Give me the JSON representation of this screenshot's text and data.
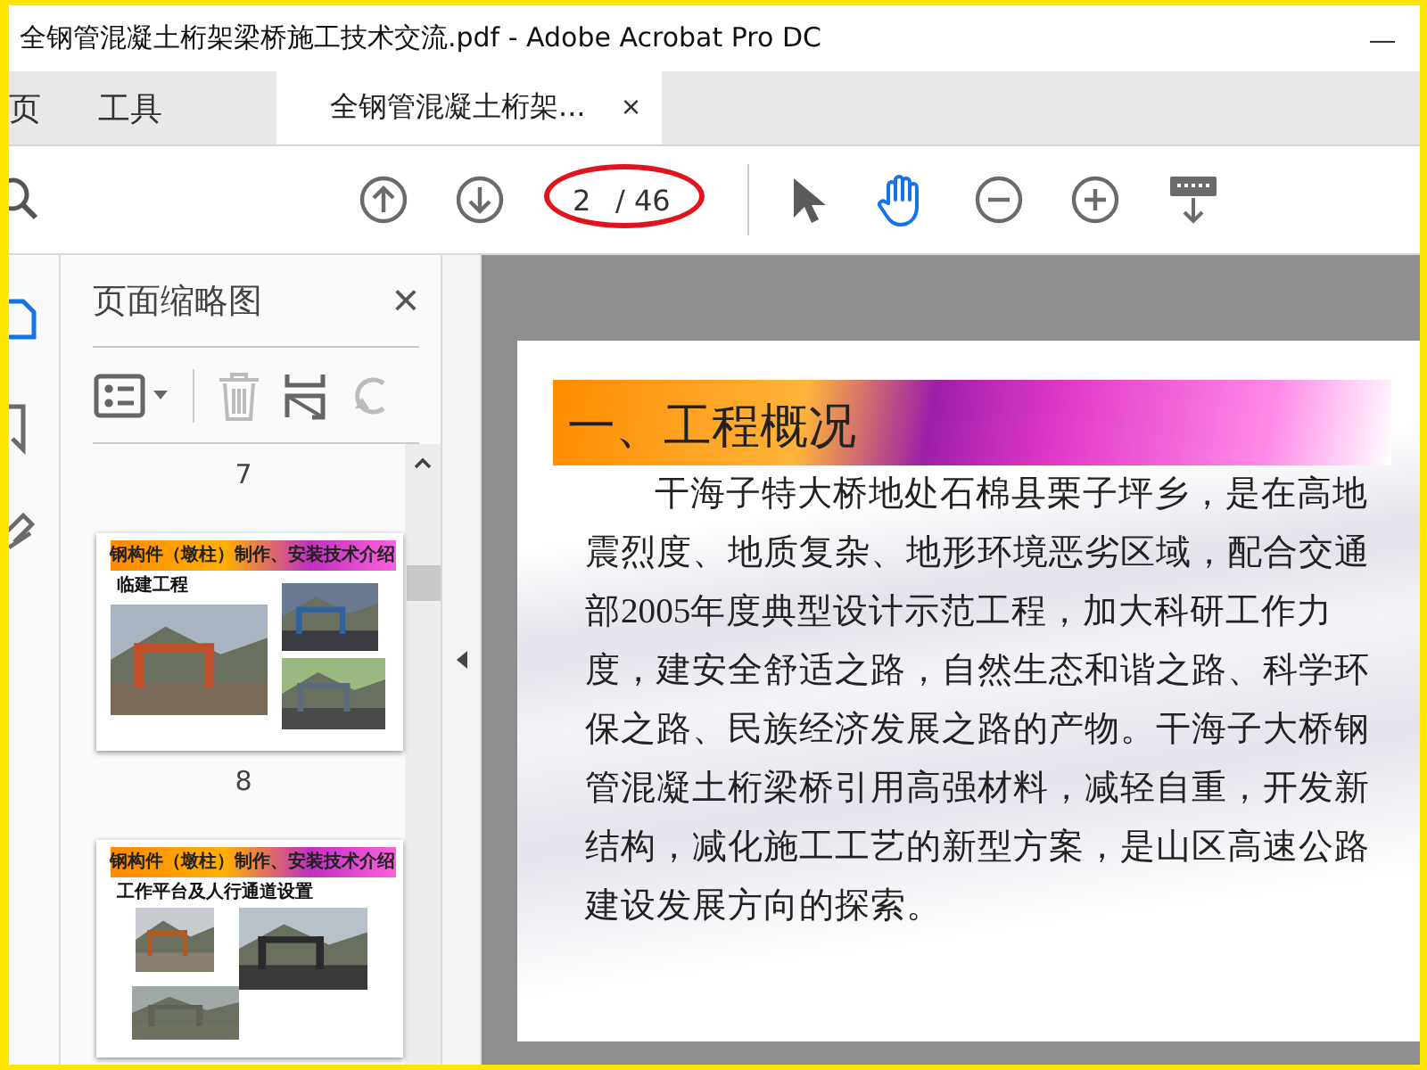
{
  "window": {
    "title": "全钢管混凝土桁架梁桥施工技术交流.pdf - Adobe Acrobat Pro DC",
    "minimize": "—"
  },
  "tabs": [
    {
      "label": "页",
      "selected": false
    },
    {
      "label": "工具",
      "selected": false
    },
    {
      "label": "全钢管混凝土桁架...",
      "selected": true,
      "close": "×"
    }
  ],
  "toolbar": {
    "page_field": {
      "value": "2",
      "total": "/ 46"
    },
    "tools": [
      {
        "kind": "select",
        "selected": false
      },
      {
        "kind": "hand",
        "selected": true
      }
    ]
  },
  "side_rail": [
    {
      "kind": "thumbnails",
      "selected": true
    },
    {
      "kind": "bookmarks",
      "selected": false
    },
    {
      "kind": "signatures",
      "selected": false
    }
  ],
  "thumbnails_panel": {
    "title": "页面缩略图",
    "close": "×",
    "items": [
      {
        "kind": "label",
        "text": "7"
      },
      {
        "kind": "thumbnail",
        "slide_title": "钢构件（墩柱）制作、安装技术介绍",
        "caption": "临建工程"
      },
      {
        "kind": "label",
        "text": "8"
      },
      {
        "kind": "thumbnail",
        "slide_title": "钢构件（墩柱）制作、安装技术介绍",
        "caption": "工作平台及人行通道设置"
      }
    ]
  },
  "document": {
    "heading": "一、工程概况",
    "paragraph": "干海子特大桥地处石棉县栗子坪乡，是在高地震烈度、地质复杂、地形环境恶劣区域，配合交通部2005年度典型设计示范工程，加大科研工作力度，建安全舒适之路，自然生态和谐之路、科学环保之路、民族经济发展之路的产物。干海子大桥钢管混凝土桁梁桥引用高强材料，减轻自重，开发新结构，减化施工工艺的新型方案，是山区高速公路建设发展方向的探索。"
  }
}
